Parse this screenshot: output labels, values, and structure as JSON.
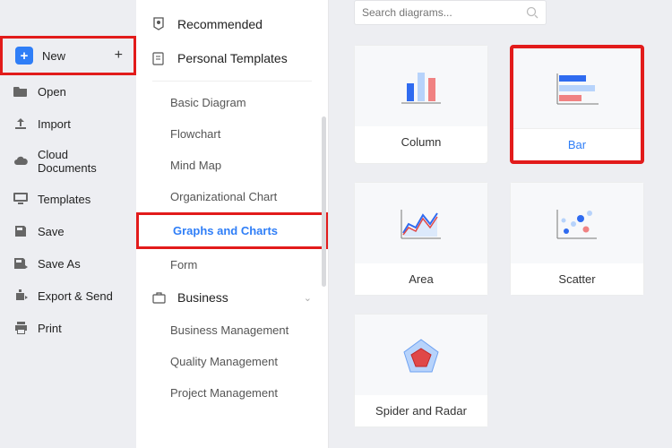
{
  "sidebar": {
    "items": [
      {
        "label": "New"
      },
      {
        "label": "Open"
      },
      {
        "label": "Import"
      },
      {
        "label": "Cloud Documents"
      },
      {
        "label": "Templates"
      },
      {
        "label": "Save"
      },
      {
        "label": "Save As"
      },
      {
        "label": "Export & Send"
      },
      {
        "label": "Print"
      }
    ]
  },
  "panel": {
    "recommended": "Recommended",
    "personal": "Personal Templates",
    "subs": [
      "Basic Diagram",
      "Flowchart",
      "Mind Map",
      "Organizational Chart",
      "Graphs and Charts",
      "Form"
    ],
    "business": "Business",
    "business_subs": [
      "Business Management",
      "Quality Management",
      "Project Management"
    ]
  },
  "search": {
    "placeholder": "Search diagrams..."
  },
  "cards": [
    {
      "label": "Column"
    },
    {
      "label": "Bar"
    },
    {
      "label": "Area"
    },
    {
      "label": "Scatter"
    },
    {
      "label": "Spider and Radar"
    }
  ]
}
